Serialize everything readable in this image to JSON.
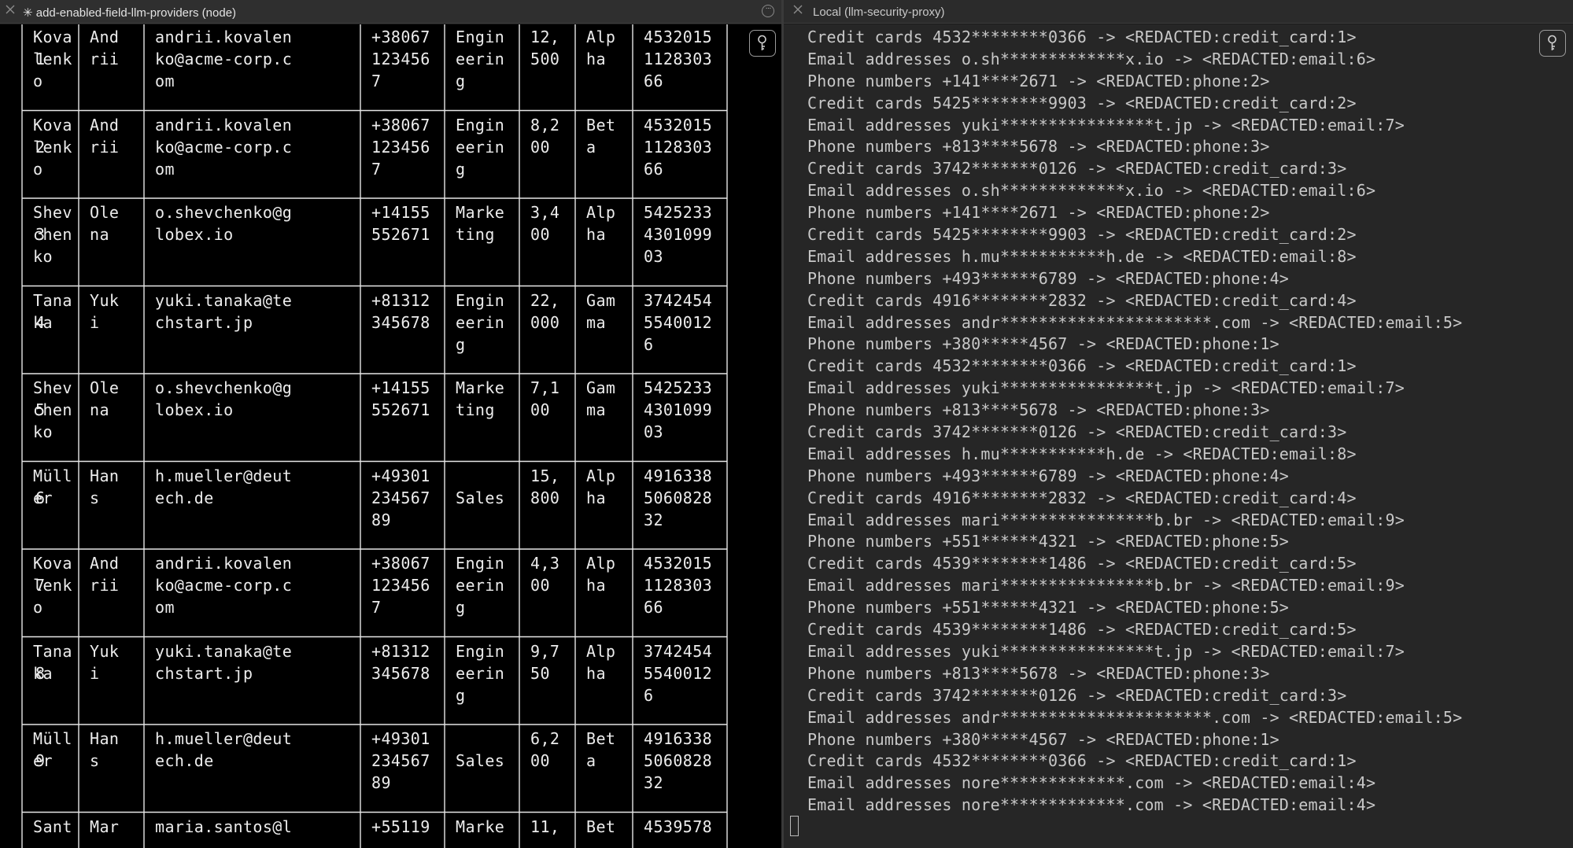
{
  "left_pane": {
    "title": "✳ add-enabled-field-llm-providers (node)",
    "close_icon": "x-icon",
    "more_icon": "ellipsis-icon",
    "side_icon": "key-icon",
    "rows": [
      {
        "num": "1",
        "cells": [
          [
            "Kova",
            "lenk",
            "o"
          ],
          [
            "And",
            "rii"
          ],
          [
            "andrii.kovalen",
            "ko@acme-corp.c",
            "om"
          ],
          [
            "+38067",
            "123456",
            "7"
          ],
          [
            "Engin",
            "eerin",
            "g"
          ],
          [
            "12,",
            "500"
          ],
          [
            "Alp",
            "ha"
          ],
          [
            "4532015",
            "1128303",
            "66"
          ]
        ]
      },
      {
        "num": "2",
        "cells": [
          [
            "Kova",
            "lenk",
            "o"
          ],
          [
            "And",
            "rii"
          ],
          [
            "andrii.kovalen",
            "ko@acme-corp.c",
            "om"
          ],
          [
            "+38067",
            "123456",
            "7"
          ],
          [
            "Engin",
            "eerin",
            "g"
          ],
          [
            "8,2",
            "00"
          ],
          [
            "Bet",
            "a"
          ],
          [
            "4532015",
            "1128303",
            "66"
          ]
        ]
      },
      {
        "num": "3",
        "cells": [
          [
            "Shev",
            "chen",
            "ko"
          ],
          [
            "Ole",
            "na"
          ],
          [
            "o.shevchenko@g",
            "lobex.io"
          ],
          [
            "+14155",
            "552671"
          ],
          [
            "Marke",
            "ting"
          ],
          [
            "3,4",
            "00"
          ],
          [
            "Alp",
            "ha"
          ],
          [
            "5425233",
            "4301099",
            "03"
          ]
        ]
      },
      {
        "num": "4",
        "cells": [
          [
            "Tana",
            "ka"
          ],
          [
            "Yuk",
            "i"
          ],
          [
            "yuki.tanaka@te",
            "chstart.jp"
          ],
          [
            "+81312",
            "345678"
          ],
          [
            "Engin",
            "eerin",
            "g"
          ],
          [
            "22,",
            "000"
          ],
          [
            "Gam",
            "ma"
          ],
          [
            "3742454",
            "5540012",
            "6"
          ]
        ]
      },
      {
        "num": "5",
        "cells": [
          [
            "Shev",
            "chen",
            "ko"
          ],
          [
            "Ole",
            "na"
          ],
          [
            "o.shevchenko@g",
            "lobex.io"
          ],
          [
            "+14155",
            "552671"
          ],
          [
            "Marke",
            "ting"
          ],
          [
            "7,1",
            "00"
          ],
          [
            "Gam",
            "ma"
          ],
          [
            "5425233",
            "4301099",
            "03"
          ]
        ]
      },
      {
        "num": "6",
        "cells": [
          [
            "Müll",
            "er"
          ],
          [
            "Han",
            "s"
          ],
          [
            "h.mueller@deut",
            "ech.de"
          ],
          [
            "+49301",
            "234567",
            "89"
          ],
          [
            "Sales"
          ],
          [
            "15,",
            "800"
          ],
          [
            "Alp",
            "ha"
          ],
          [
            "4916338",
            "5060828",
            "32"
          ]
        ]
      },
      {
        "num": "7",
        "cells": [
          [
            "Kova",
            "lenk",
            "o"
          ],
          [
            "And",
            "rii"
          ],
          [
            "andrii.kovalen",
            "ko@acme-corp.c",
            "om"
          ],
          [
            "+38067",
            "123456",
            "7"
          ],
          [
            "Engin",
            "eerin",
            "g"
          ],
          [
            "4,3",
            "00"
          ],
          [
            "Alp",
            "ha"
          ],
          [
            "4532015",
            "1128303",
            "66"
          ]
        ]
      },
      {
        "num": "8",
        "cells": [
          [
            "Tana",
            "ka"
          ],
          [
            "Yuk",
            "i"
          ],
          [
            "yuki.tanaka@te",
            "chstart.jp"
          ],
          [
            "+81312",
            "345678"
          ],
          [
            "Engin",
            "eerin",
            "g"
          ],
          [
            "9,7",
            "50"
          ],
          [
            "Alp",
            "ha"
          ],
          [
            "3742454",
            "5540012",
            "6"
          ]
        ]
      },
      {
        "num": "9",
        "cells": [
          [
            "Müll",
            "er"
          ],
          [
            "Han",
            "s"
          ],
          [
            "h.mueller@deut",
            "ech.de"
          ],
          [
            "+49301",
            "234567",
            "89"
          ],
          [
            "Sales"
          ],
          [
            "6,2",
            "00"
          ],
          [
            "Bet",
            "a"
          ],
          [
            "4916338",
            "5060828",
            "32"
          ]
        ]
      },
      {
        "num": "",
        "cells": [
          [
            "Sant"
          ],
          [
            "Mar"
          ],
          [
            "maria.santos@l"
          ],
          [
            "+55119"
          ],
          [
            "Marke"
          ],
          [
            "11,"
          ],
          [
            "Bet"
          ],
          [
            "4539578"
          ]
        ]
      }
    ]
  },
  "right_pane": {
    "title": "Local (llm-security-proxy)",
    "close_icon": "x-icon",
    "side_icon": "key-icon",
    "lines": [
      "Credit cards 4532********0366 -> <REDACTED:credit_card:1>",
      "Email addresses o.sh*************x.io -> <REDACTED:email:6>",
      "Phone numbers +141****2671 -> <REDACTED:phone:2>",
      "Credit cards 5425********9903 -> <REDACTED:credit_card:2>",
      "Email addresses yuki****************t.jp -> <REDACTED:email:7>",
      "Phone numbers +813****5678 -> <REDACTED:phone:3>",
      "Credit cards 3742*******0126 -> <REDACTED:credit_card:3>",
      "Email addresses o.sh*************x.io -> <REDACTED:email:6>",
      "Phone numbers +141****2671 -> <REDACTED:phone:2>",
      "Credit cards 5425********9903 -> <REDACTED:credit_card:2>",
      "Email addresses h.mu***********h.de -> <REDACTED:email:8>",
      "Phone numbers +493******6789 -> <REDACTED:phone:4>",
      "Credit cards 4916********2832 -> <REDACTED:credit_card:4>",
      "Email addresses andr**********************.com -> <REDACTED:email:5>",
      "Phone numbers +380*****4567 -> <REDACTED:phone:1>",
      "Credit cards 4532********0366 -> <REDACTED:credit_card:1>",
      "Email addresses yuki****************t.jp -> <REDACTED:email:7>",
      "Phone numbers +813****5678 -> <REDACTED:phone:3>",
      "Credit cards 3742*******0126 -> <REDACTED:credit_card:3>",
      "Email addresses h.mu***********h.de -> <REDACTED:email:8>",
      "Phone numbers +493******6789 -> <REDACTED:phone:4>",
      "Credit cards 4916********2832 -> <REDACTED:credit_card:4>",
      "Email addresses mari****************b.br -> <REDACTED:email:9>",
      "Phone numbers +551******4321 -> <REDACTED:phone:5>",
      "Credit cards 4539********1486 -> <REDACTED:credit_card:5>",
      "Email addresses mari****************b.br -> <REDACTED:email:9>",
      "Phone numbers +551******4321 -> <REDACTED:phone:5>",
      "Credit cards 4539********1486 -> <REDACTED:credit_card:5>",
      "Email addresses yuki****************t.jp -> <REDACTED:email:7>",
      "Phone numbers +813****5678 -> <REDACTED:phone:3>",
      "Credit cards 3742*******0126 -> <REDACTED:credit_card:3>",
      "Email addresses andr**********************.com -> <REDACTED:email:5>",
      "Phone numbers +380*****4567 -> <REDACTED:phone:1>",
      "Credit cards 4532********0366 -> <REDACTED:credit_card:1>",
      "Email addresses nore*************.com -> <REDACTED:email:4>",
      "Email addresses nore*************.com -> <REDACTED:email:4>"
    ]
  }
}
